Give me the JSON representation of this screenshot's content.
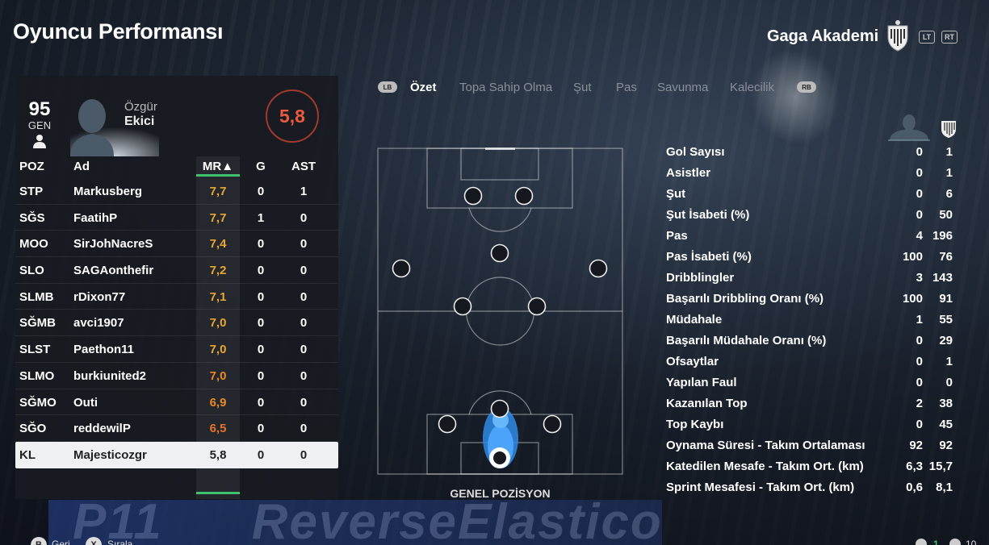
{
  "header": {
    "title": "Oyuncu Performansı",
    "team_name": "Gaga Akademi",
    "lt": "LT",
    "rt": "RT"
  },
  "player": {
    "ovr": "95",
    "ovr_label": "GEN",
    "first_name": "Özgür",
    "last_name": "Ekici",
    "rating": "5,8"
  },
  "table": {
    "headers": {
      "poz": "POZ",
      "ad": "Ad",
      "mr": "MR▲",
      "g": "G",
      "ast": "AST"
    },
    "rows": [
      {
        "poz": "STP",
        "ad": "Markusberg",
        "mr": "7,7",
        "g": "0",
        "ast": "1",
        "color": "#e8a72e"
      },
      {
        "poz": "SĞS",
        "ad": "FaatihP",
        "mr": "7,7",
        "g": "1",
        "ast": "0",
        "color": "#e8a72e"
      },
      {
        "poz": "MOO",
        "ad": "SirJohNacreS",
        "mr": "7,4",
        "g": "0",
        "ast": "0",
        "color": "#e8a72e"
      },
      {
        "poz": "SLO",
        "ad": "SAGAonthefir",
        "mr": "7,2",
        "g": "0",
        "ast": "0",
        "color": "#e8a72e"
      },
      {
        "poz": "SLMB",
        "ad": "rDixon77",
        "mr": "7,1",
        "g": "0",
        "ast": "0",
        "color": "#e8a72e"
      },
      {
        "poz": "SĞMB",
        "ad": "avci1907",
        "mr": "7,0",
        "g": "0",
        "ast": "0",
        "color": "#e8a72e"
      },
      {
        "poz": "SLST",
        "ad": "Paethon11",
        "mr": "7,0",
        "g": "0",
        "ast": "0",
        "color": "#e8a72e"
      },
      {
        "poz": "SLMO",
        "ad": "burkiunited2",
        "mr": "7,0",
        "g": "0",
        "ast": "0",
        "color": "#e88a25"
      },
      {
        "poz": "SĞMO",
        "ad": "Outi",
        "mr": "6,9",
        "g": "0",
        "ast": "0",
        "color": "#e88a25"
      },
      {
        "poz": "SĞO",
        "ad": "reddewilP",
        "mr": "6,5",
        "g": "0",
        "ast": "0",
        "color": "#e8722a"
      },
      {
        "poz": "KL",
        "ad": "Majesticozgr",
        "mr": "5,8",
        "g": "0",
        "ast": "0",
        "color": "#222222",
        "selected": true
      }
    ]
  },
  "tabs": {
    "lb": "LB",
    "rb": "RB",
    "items": [
      "Özet",
      "Topa Sahip Olma",
      "Şut",
      "Pas",
      "Savunma",
      "Kalecilik"
    ],
    "active": "Özet"
  },
  "pitch": {
    "label": "GENEL POZİSYON",
    "heat_color": "#2f8be6"
  },
  "stats": [
    {
      "label": "Gol Sayısı",
      "player": "0",
      "team": "1"
    },
    {
      "label": "Asistler",
      "player": "0",
      "team": "1"
    },
    {
      "label": "Şut",
      "player": "0",
      "team": "6"
    },
    {
      "label": "Şut İsabeti (%)",
      "player": "0",
      "team": "50"
    },
    {
      "label": "Pas",
      "player": "4",
      "team": "196"
    },
    {
      "label": "Pas İsabeti (%)",
      "player": "100",
      "team": "76"
    },
    {
      "label": "Dribblingler",
      "player": "3",
      "team": "143"
    },
    {
      "label": "Başarılı Dribbling Oranı (%)",
      "player": "100",
      "team": "91"
    },
    {
      "label": "Müdahale",
      "player": "1",
      "team": "55"
    },
    {
      "label": "Başarılı Müdahale Oranı (%)",
      "player": "0",
      "team": "29"
    },
    {
      "label": "Ofsaytlar",
      "player": "0",
      "team": "1"
    },
    {
      "label": "Yapılan Faul",
      "player": "0",
      "team": "0"
    },
    {
      "label": "Kazanılan Top",
      "player": "2",
      "team": "38"
    },
    {
      "label": "Top Kaybı",
      "player": "0",
      "team": "45"
    },
    {
      "label": "Oynama Süresi - Takım Ortalaması",
      "player": "92",
      "team": "92"
    },
    {
      "label": "Katedilen Mesafe - Takım Ort. (km)",
      "player": "6,3",
      "team": "15,7"
    },
    {
      "label": "Sprint Mesafesi - Takım Ort. (km)",
      "player": "0,6",
      "team": "8,1"
    }
  ],
  "bottom": {
    "back_btn": "B",
    "back_label": "Geri",
    "sort_btn": "X",
    "sort_label": "Sırala",
    "count1": "1",
    "count2": "10"
  },
  "background": {
    "banner_left": "P11",
    "banner_right": "ReverseElastico"
  },
  "colors": {
    "accent_green": "#3ec26e",
    "rating_red": "#ea5a3e",
    "mr_orange": "#e8a72e"
  }
}
